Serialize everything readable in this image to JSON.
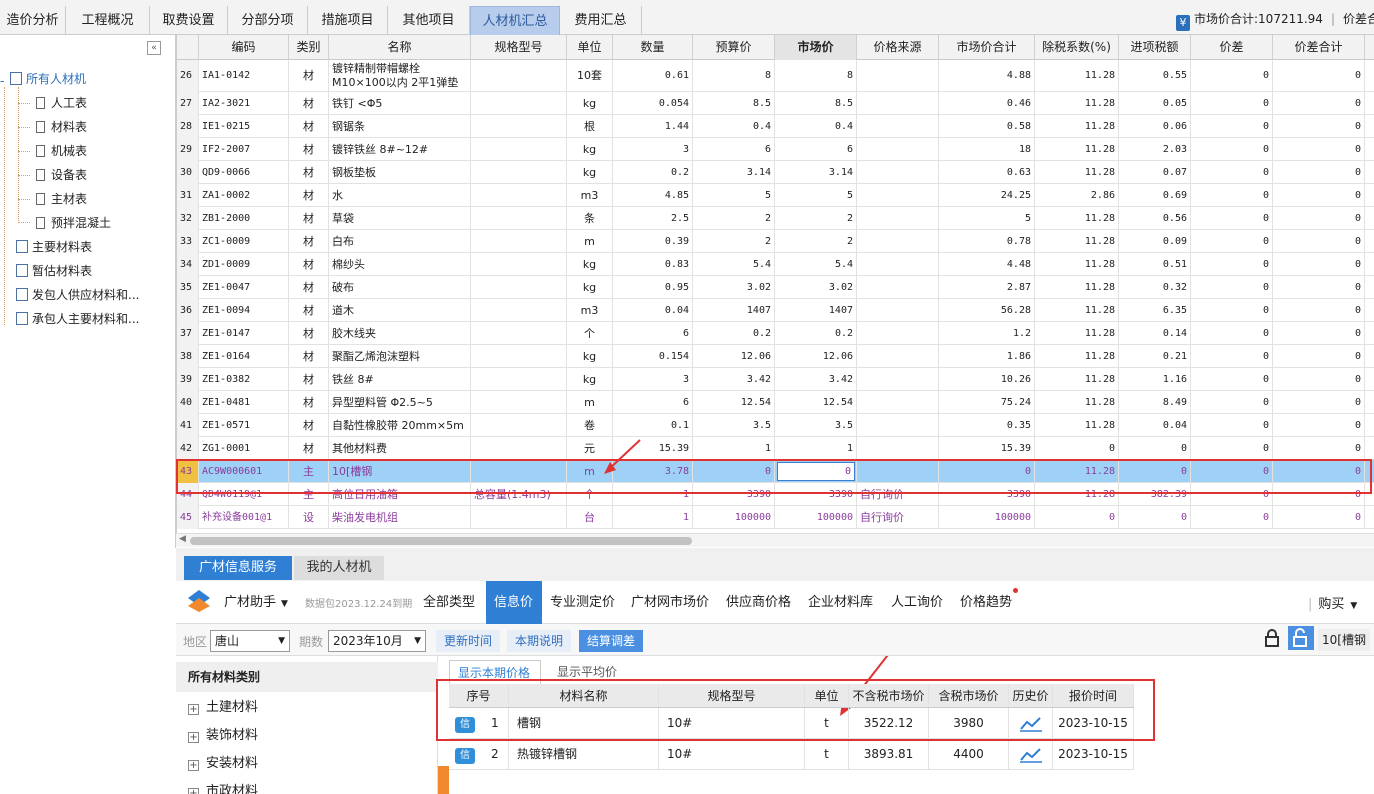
{
  "tabs": [
    "造价分析",
    "工程概况",
    "取费设置",
    "分部分项",
    "措施项目",
    "其他项目",
    "人材机汇总",
    "费用汇总"
  ],
  "market_total": {
    "label": "市场价合计:107211.94",
    "next": "价差合"
  },
  "tree": {
    "root": "所有人材机",
    "children": [
      "人工表",
      "材料表",
      "机械表",
      "设备表",
      "主材表",
      "预拌混凝土"
    ],
    "others": [
      "主要材料表",
      "暂估材料表",
      "发包人供应材料和...",
      "承包人主要材料和..."
    ]
  },
  "columns": [
    "编码",
    "类别",
    "名称",
    "规格型号",
    "单位",
    "数量",
    "预算价",
    "市场价",
    "价格来源",
    "市场价合计",
    "除税系数(%)",
    "进项税额",
    "价差",
    "价差合计"
  ],
  "rows": [
    {
      "n": "26",
      "code": "IA1-0142",
      "type": "材",
      "name": "镀锌精制带帽螺栓",
      "name2": "M10×100以内 2平1弹垫",
      "spec": "",
      "unit": "10套",
      "qty": "0.61",
      "budget": "8",
      "market": "8",
      "src": "",
      "total": "4.88",
      "tax": "11.28",
      "input": "0.55",
      "diff": "0",
      "difftotal": "0"
    },
    {
      "n": "27",
      "code": "IA2-3021",
      "type": "材",
      "name": "铁钉 <Φ5",
      "spec": "",
      "unit": "kg",
      "qty": "0.054",
      "budget": "8.5",
      "market": "8.5",
      "src": "",
      "total": "0.46",
      "tax": "11.28",
      "input": "0.05",
      "diff": "0",
      "difftotal": "0"
    },
    {
      "n": "28",
      "code": "IE1-0215",
      "type": "材",
      "name": "钢锯条",
      "spec": "",
      "unit": "根",
      "qty": "1.44",
      "budget": "0.4",
      "market": "0.4",
      "src": "",
      "total": "0.58",
      "tax": "11.28",
      "input": "0.06",
      "diff": "0",
      "difftotal": "0"
    },
    {
      "n": "29",
      "code": "IF2-2007",
      "type": "材",
      "name": "镀锌铁丝 8#~12#",
      "spec": "",
      "unit": "kg",
      "qty": "3",
      "budget": "6",
      "market": "6",
      "src": "",
      "total": "18",
      "tax": "11.28",
      "input": "2.03",
      "diff": "0",
      "difftotal": "0"
    },
    {
      "n": "30",
      "code": "QD9-0066",
      "type": "材",
      "name": "钢板垫板",
      "spec": "",
      "unit": "kg",
      "qty": "0.2",
      "budget": "3.14",
      "market": "3.14",
      "src": "",
      "total": "0.63",
      "tax": "11.28",
      "input": "0.07",
      "diff": "0",
      "difftotal": "0"
    },
    {
      "n": "31",
      "code": "ZA1-0002",
      "type": "材",
      "name": "水",
      "spec": "",
      "unit": "m3",
      "qty": "4.85",
      "budget": "5",
      "market": "5",
      "src": "",
      "total": "24.25",
      "tax": "2.86",
      "input": "0.69",
      "diff": "0",
      "difftotal": "0"
    },
    {
      "n": "32",
      "code": "ZB1-2000",
      "type": "材",
      "name": "草袋",
      "spec": "",
      "unit": "条",
      "qty": "2.5",
      "budget": "2",
      "market": "2",
      "src": "",
      "total": "5",
      "tax": "11.28",
      "input": "0.56",
      "diff": "0",
      "difftotal": "0"
    },
    {
      "n": "33",
      "code": "ZC1-0009",
      "type": "材",
      "name": "白布",
      "spec": "",
      "unit": "m",
      "qty": "0.39",
      "budget": "2",
      "market": "2",
      "src": "",
      "total": "0.78",
      "tax": "11.28",
      "input": "0.09",
      "diff": "0",
      "difftotal": "0"
    },
    {
      "n": "34",
      "code": "ZD1-0009",
      "type": "材",
      "name": "棉纱头",
      "spec": "",
      "unit": "kg",
      "qty": "0.83",
      "budget": "5.4",
      "market": "5.4",
      "src": "",
      "total": "4.48",
      "tax": "11.28",
      "input": "0.51",
      "diff": "0",
      "difftotal": "0"
    },
    {
      "n": "35",
      "code": "ZE1-0047",
      "type": "材",
      "name": "破布",
      "spec": "",
      "unit": "kg",
      "qty": "0.95",
      "budget": "3.02",
      "market": "3.02",
      "src": "",
      "total": "2.87",
      "tax": "11.28",
      "input": "0.32",
      "diff": "0",
      "difftotal": "0"
    },
    {
      "n": "36",
      "code": "ZE1-0094",
      "type": "材",
      "name": "道木",
      "spec": "",
      "unit": "m3",
      "qty": "0.04",
      "budget": "1407",
      "market": "1407",
      "src": "",
      "total": "56.28",
      "tax": "11.28",
      "input": "6.35",
      "diff": "0",
      "difftotal": "0"
    },
    {
      "n": "37",
      "code": "ZE1-0147",
      "type": "材",
      "name": "胶木线夹",
      "spec": "",
      "unit": "个",
      "qty": "6",
      "budget": "0.2",
      "market": "0.2",
      "src": "",
      "total": "1.2",
      "tax": "11.28",
      "input": "0.14",
      "diff": "0",
      "difftotal": "0"
    },
    {
      "n": "38",
      "code": "ZE1-0164",
      "type": "材",
      "name": "聚酯乙烯泡沫塑料",
      "spec": "",
      "unit": "kg",
      "qty": "0.154",
      "budget": "12.06",
      "market": "12.06",
      "src": "",
      "total": "1.86",
      "tax": "11.28",
      "input": "0.21",
      "diff": "0",
      "difftotal": "0"
    },
    {
      "n": "39",
      "code": "ZE1-0382",
      "type": "材",
      "name": "铁丝 8#",
      "spec": "",
      "unit": "kg",
      "qty": "3",
      "budget": "3.42",
      "market": "3.42",
      "src": "",
      "total": "10.26",
      "tax": "11.28",
      "input": "1.16",
      "diff": "0",
      "difftotal": "0"
    },
    {
      "n": "40",
      "code": "ZE1-0481",
      "type": "材",
      "name": "异型塑料管 Φ2.5~5",
      "spec": "",
      "unit": "m",
      "qty": "6",
      "budget": "12.54",
      "market": "12.54",
      "src": "",
      "total": "75.24",
      "tax": "11.28",
      "input": "8.49",
      "diff": "0",
      "difftotal": "0"
    },
    {
      "n": "41",
      "code": "ZE1-0571",
      "type": "材",
      "name": "自黏性橡胶带 20mm×5m",
      "spec": "",
      "unit": "卷",
      "qty": "0.1",
      "budget": "3.5",
      "market": "3.5",
      "src": "",
      "total": "0.35",
      "tax": "11.28",
      "input": "0.04",
      "diff": "0",
      "difftotal": "0"
    },
    {
      "n": "42",
      "code": "ZG1-0001",
      "type": "材",
      "name": "其他材料费",
      "spec": "",
      "unit": "元",
      "qty": "15.39",
      "budget": "1",
      "market": "1",
      "src": "",
      "total": "15.39",
      "tax": "0",
      "input": "0",
      "diff": "0",
      "difftotal": "0"
    },
    {
      "n": "43",
      "code": "AC9W000601",
      "type": "主",
      "name": "10[槽钢",
      "spec": "",
      "unit": "m",
      "qty": "3.78",
      "budget": "0",
      "market": "0",
      "src": "",
      "total": "0",
      "tax": "11.28",
      "input": "0",
      "diff": "0",
      "difftotal": "0",
      "sel": true
    },
    {
      "n": "44",
      "code": "QD4W0119@1",
      "type": "主",
      "name": "高位日用油箱",
      "spec": "总容量(1.4m3)",
      "unit": "个",
      "qty": "1",
      "budget": "3390",
      "market": "3390",
      "src": "自行询价",
      "total": "3390",
      "tax": "11.28",
      "input": "382.39",
      "diff": "0",
      "difftotal": "0",
      "purple": true
    },
    {
      "n": "45",
      "code": "补充设备001@1",
      "type": "设",
      "name": "柴油发电机组",
      "spec": "",
      "unit": "台",
      "qty": "1",
      "budget": "100000",
      "market": "100000",
      "src": "自行询价",
      "total": "100000",
      "tax": "0",
      "input": "0",
      "diff": "0",
      "difftotal": "0",
      "purple": true
    }
  ],
  "bottom_tabs": [
    "广材信息服务",
    "我的人材机"
  ],
  "assistant": {
    "name": "广材助手",
    "pkg": "数据包2023.12.24到期",
    "tabs": [
      "全部类型",
      "信息价",
      "专业测定价",
      "广材网市场价",
      "供应商价格",
      "企业材料库",
      "人工询价",
      "价格趋势"
    ],
    "buy": "购买"
  },
  "filter": {
    "region_label": "地区",
    "region": "唐山",
    "period_label": "期数",
    "period": "2023年10月",
    "btn_update": "更新时间",
    "btn_note": "本期说明",
    "btn_settle": "结算调差",
    "search": "10[槽钢"
  },
  "categories": {
    "title": "所有材料类别",
    "items": [
      "土建材料",
      "装饰材料",
      "安装材料",
      "市政材料"
    ]
  },
  "price_tabs": [
    "显示本期价格",
    "显示平均价"
  ],
  "price_cols": [
    "序号",
    "材料名称",
    "规格型号",
    "单位",
    "不含税市场价",
    "含税市场价",
    "历史价",
    "报价时间"
  ],
  "price_rows": [
    {
      "badge": "信",
      "n": "1",
      "name": "槽钢",
      "spec": "10#",
      "unit": "t",
      "ex": "3522.12",
      "inc": "3980",
      "date": "2023-10-15"
    },
    {
      "badge": "信",
      "n": "2",
      "name": "热镀锌槽钢",
      "spec": "10#",
      "unit": "t",
      "ex": "3893.81",
      "inc": "4400",
      "date": "2023-10-15"
    }
  ],
  "colors": {
    "accent": "#2f7fd5",
    "selected_row": "#9fd0f6",
    "highlight_red": "#e03232",
    "main_material": "#8a3c9c"
  }
}
